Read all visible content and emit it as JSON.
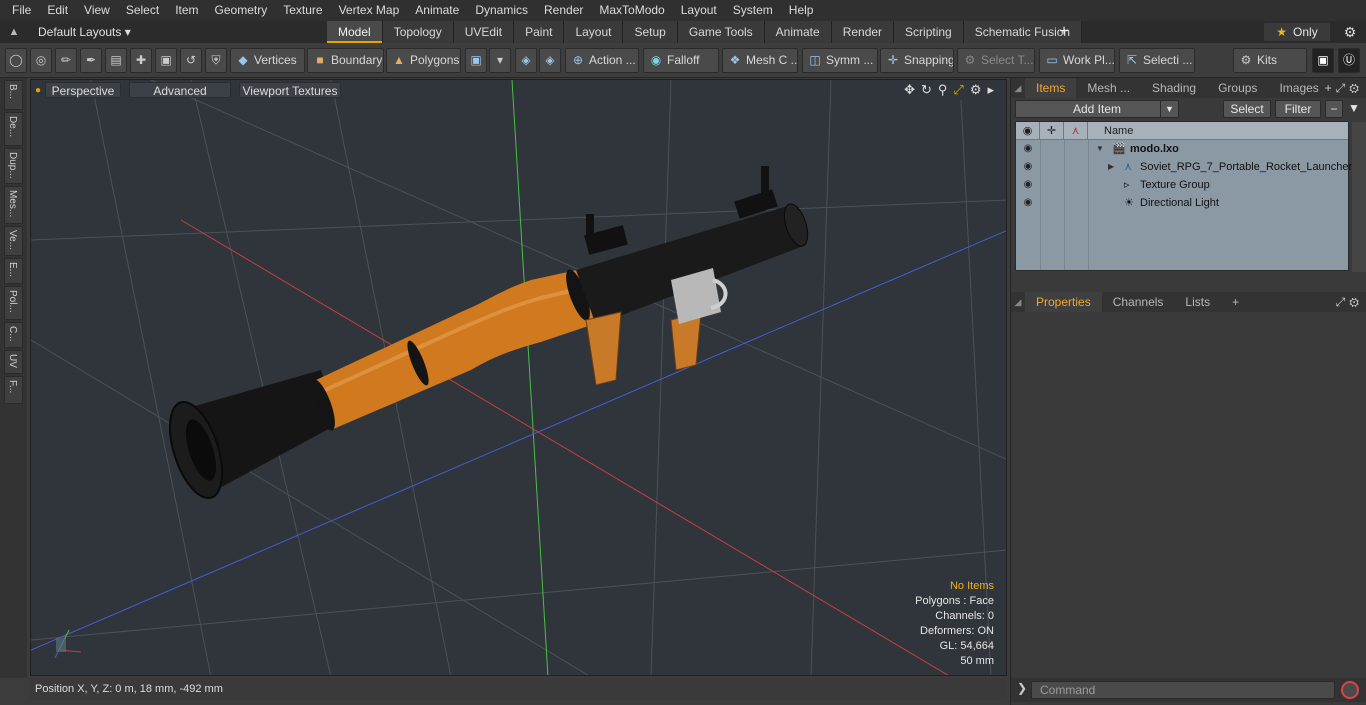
{
  "menu": [
    "File",
    "Edit",
    "View",
    "Select",
    "Item",
    "Geometry",
    "Texture",
    "Vertex Map",
    "Animate",
    "Dynamics",
    "Render",
    "MaxToModo",
    "Layout",
    "System",
    "Help"
  ],
  "layoutbar": {
    "home_icon": "home-icon",
    "layout_select": "Default Layouts ▾",
    "tabs": [
      "Model",
      "Topology",
      "UVEdit",
      "Paint",
      "Layout",
      "Setup",
      "Game Tools",
      "Animate",
      "Render",
      "Scripting",
      "Schematic Fusion"
    ],
    "active_tab": "Model",
    "add_tab": "+",
    "only_label": "Only",
    "accent": "#e8a200"
  },
  "toolbar": {
    "vertices": "Vertices",
    "boundary": "Boundary",
    "polygons": "Polygons",
    "action": "Action ...",
    "falloff": "Falloff",
    "mesh_c": "Mesh C ...",
    "symm": "Symm ...",
    "snapping": "Snapping",
    "select_t": "Select T...",
    "work_pl": "Work Pl...",
    "selecti": "Selecti ...",
    "kits": "Kits"
  },
  "left_tabs": [
    "B...",
    "De...",
    "Dup...",
    "Mes...",
    "Ve...",
    "E...",
    "Pol...",
    "C...",
    "UV",
    "F..."
  ],
  "viewport": {
    "perspective": "Perspective",
    "advanced": "Advanced",
    "viewport_textures": "Viewport Textures",
    "hud": {
      "no_items": "No Items",
      "polygons": "Polygons : Face",
      "channels": "Channels: 0",
      "deformers": "Deformers: ON",
      "gl": "GL: 54,664",
      "size": "50 mm"
    },
    "gizmo": {
      "y": "Y",
      "x": "X",
      "z": "Z"
    }
  },
  "status": {
    "position": "Position X, Y, Z:  0 m, 18 mm, -492 mm"
  },
  "items_panel": {
    "tabs": [
      "Items",
      "Mesh ...",
      "Shading",
      "Groups",
      "Images"
    ],
    "active_tab": "Items",
    "add_item": "Add Item",
    "select": "Select",
    "filter": "Filter",
    "column_name": "Name",
    "rows": [
      {
        "label": "modo.lxo",
        "icon": "scene-icon"
      },
      {
        "label": "Soviet_RPG_7_Portable_Rocket_Launcher",
        "icon": "mesh-icon"
      },
      {
        "label": "Texture Group",
        "icon": "texture-group-icon"
      },
      {
        "label": "Directional Light",
        "icon": "light-icon"
      }
    ]
  },
  "properties_panel": {
    "tabs": [
      "Properties",
      "Channels",
      "Lists"
    ],
    "active_tab": "Properties",
    "add": "+"
  },
  "command": {
    "placeholder": "Command"
  }
}
